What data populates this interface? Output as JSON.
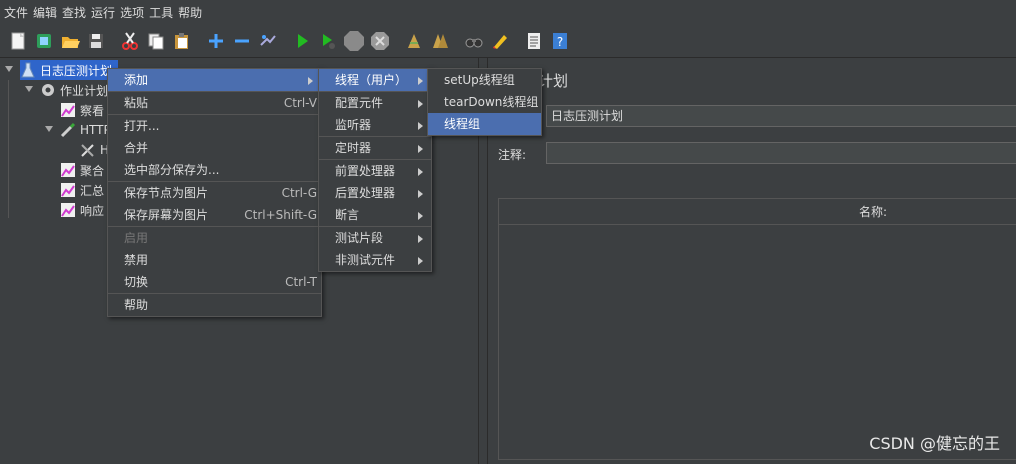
{
  "menubar": [
    "文件",
    "编辑",
    "查找",
    "运行",
    "选项",
    "工具",
    "帮助"
  ],
  "toolbar_icons": [
    "new-icon",
    "templates-icon",
    "open-icon",
    "save-icon",
    "cut-icon",
    "copy-icon",
    "paste-icon",
    "expand-icon",
    "collapse-icon",
    "toggle-icon",
    "start-icon",
    "start-no-pause-icon",
    "stop-icon",
    "shutdown-icon",
    "clear-icon",
    "clear-all-icon",
    "search-icon",
    "reset-search-icon",
    "function-helper-icon",
    "help-icon"
  ],
  "tree": {
    "root": "日志压测计划",
    "thread_group": "作业计划",
    "n1": "察看",
    "n2": "HTTP",
    "n3": "H",
    "n4": "聚合",
    "n5": "汇总",
    "n6": "响应"
  },
  "right": {
    "title_partial": "计划",
    "name_value": "日志压测计划",
    "comment_label": "注释:",
    "table_header": "名称:"
  },
  "context_menu": {
    "add": "添加",
    "paste": "粘贴",
    "paste_sc": "Ctrl-V",
    "open": "打开...",
    "merge": "合并",
    "save_selection": "选中部分保存为...",
    "save_node_image": "保存节点为图片",
    "save_node_image_sc": "Ctrl-G",
    "save_screen_image": "保存屏幕为图片",
    "save_screen_image_sc": "Ctrl+Shift-G",
    "enable": "启用",
    "disable": "禁用",
    "toggle": "切换",
    "toggle_sc": "Ctrl-T",
    "help": "帮助"
  },
  "add_submenu": {
    "threads": "线程（用户）",
    "config": "配置元件",
    "listener": "监听器",
    "timer": "定时器",
    "pre": "前置处理器",
    "post": "后置处理器",
    "assertion": "断言",
    "fragment": "测试片段",
    "non_test": "非测试元件"
  },
  "threads_submenu": {
    "setup": "setUp线程组",
    "teardown": "tearDown线程组",
    "group": "线程组"
  },
  "watermark": "CSDN @健忘的王"
}
